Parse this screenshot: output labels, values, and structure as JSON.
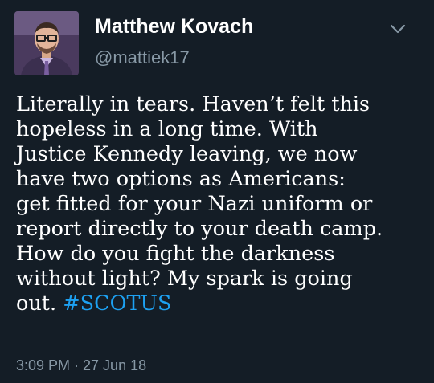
{
  "tweet": {
    "author": {
      "display_name": "Matthew Kovach",
      "handle": "@mattiek17"
    },
    "body": "Literally in tears. Haven’t felt this\nhopeless in a long time. With\nJustice Kennedy leaving, we now\nhave two options as Americans:\nget fitted for your Nazi uniform or\nreport directly to your death camp.\nHow do you fight the darkness\nwithout light? My spark is going\nout. ",
    "hashtag": "#SCOTUS",
    "timestamp": "3:09 PM · 27 Jun 18"
  },
  "icons": {
    "menu": "chevron-down-icon",
    "avatar": "profile-photo"
  },
  "colors": {
    "background": "#141d26",
    "text": "#ffffff",
    "secondary": "#8899a6",
    "link": "#1da1f2"
  }
}
